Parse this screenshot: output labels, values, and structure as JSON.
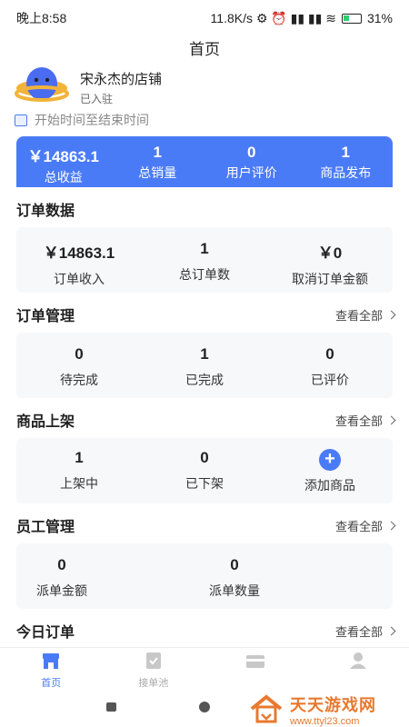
{
  "status": {
    "time": "晚上8:58",
    "right": "11.8K/s ⚙ ⏰ ▮▮ ▮▮ ≋",
    "battery": "31%"
  },
  "header": {
    "title": "首页"
  },
  "shop": {
    "name": "宋永杰的店铺",
    "status": "已入驻"
  },
  "date_range": "开始时间至结束时间",
  "summary": [
    {
      "value": "￥14863.1",
      "label": "总收益"
    },
    {
      "value": "1",
      "label": "总销量"
    },
    {
      "value": "0",
      "label": "用户评价"
    },
    {
      "value": "1",
      "label": "商品发布"
    }
  ],
  "order_data": {
    "title": "订单数据",
    "items": [
      {
        "value": "￥14863.1",
        "label": "订单收入"
      },
      {
        "value": "1",
        "label": "总订单数"
      },
      {
        "value": "￥0",
        "label": "取消订单金额"
      }
    ]
  },
  "order_manage": {
    "title": "订单管理",
    "more": "查看全部",
    "items": [
      {
        "value": "0",
        "label": "待完成"
      },
      {
        "value": "1",
        "label": "已完成"
      },
      {
        "value": "0",
        "label": "已评价"
      }
    ]
  },
  "product": {
    "title": "商品上架",
    "more": "查看全部",
    "items": [
      {
        "value": "1",
        "label": "上架中"
      },
      {
        "value": "0",
        "label": "已下架"
      }
    ],
    "add_label": "添加商品"
  },
  "staff": {
    "title": "员工管理",
    "more": "查看全部",
    "items": [
      {
        "value": "0",
        "label": "派单金额"
      },
      {
        "value": "0",
        "label": "派单数量"
      }
    ]
  },
  "today": {
    "title": "今日订单",
    "more": "查看全部"
  },
  "tabs": [
    {
      "label": "首页",
      "icon": "shop-icon"
    },
    {
      "label": "接单池",
      "icon": "check-icon"
    },
    {
      "label": "",
      "icon": "wallet-icon"
    },
    {
      "label": "",
      "icon": "user-icon"
    }
  ],
  "watermark": {
    "name": "天天游戏网",
    "url": "www.ttyl23.com"
  },
  "colors": {
    "accent": "#4a7bf7",
    "watermark": "#e8792f"
  }
}
